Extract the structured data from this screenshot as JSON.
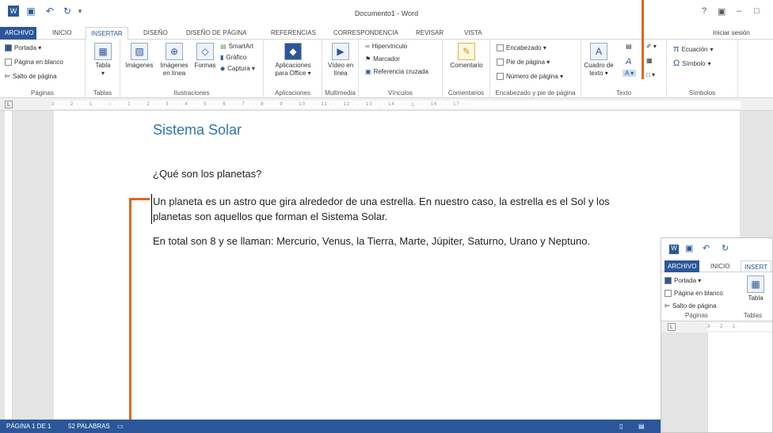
{
  "window": {
    "title": "Documento1 - Word",
    "help": "?",
    "signin": "Iniciar sesión"
  },
  "qat": {
    "word_icon": "word-logo-icon",
    "save": "save-icon",
    "undo": "undo-icon",
    "redo": "redo-icon",
    "customize": "customize-icon"
  },
  "tabs": [
    "ARCHIVO",
    "INICIO",
    "INSERTAR",
    "DISEÑO",
    "DISEÑO DE PÁGINA",
    "REFERENCIAS",
    "CORRESPONDENCIA",
    "REVISAR",
    "VISTA"
  ],
  "ribbon": {
    "paginas": {
      "label": "Páginas",
      "items": [
        "Portada ▾",
        "Página en blanco",
        "Salto de página"
      ]
    },
    "tablas": {
      "label": "Tablas",
      "tabla": "Tabla"
    },
    "ilustraciones": {
      "label": "Ilustraciones",
      "imagenes": "Imágenes",
      "imagenes_linea": "Imágenes en línea",
      "formas": "Formas",
      "smartart": "SmartArt",
      "grafico": "Gráfico",
      "captura": "Captura ▾"
    },
    "aplicaciones": {
      "label": "Aplicaciones",
      "apps": "Aplicaciones para Office ▾"
    },
    "multimedia": {
      "label": "Multimedia",
      "video": "Vídeo en línea"
    },
    "vinculos": {
      "label": "Vínculos",
      "items": [
        "Hipervínculo",
        "Marcador",
        "Referencia cruzada"
      ]
    },
    "comentarios": {
      "label": "Comentarios",
      "comentario": "Comentario"
    },
    "encabezado": {
      "label": "Encabezado y pie de página",
      "items": [
        "Encabezado ▾",
        "Pie de página ▾",
        "Número de página ▾"
      ]
    },
    "texto": {
      "label": "Texto",
      "cuadro": "Cuadro de texto ▾"
    },
    "simbolos": {
      "label": "Símbolos",
      "ecuacion": "Ecuación",
      "simbolo": "Símbolo"
    }
  },
  "ruler": "3 · · · 2 · · · 1 · · · ⌂ · · · 1 · · · 2 · · · 3 · · · 4 · · · 5 · · · 6 · · · 7 · · · 8 · · · 9 · · · 10 · · · 11 · · · 12 · · · 13 · · · 14 · · · △ · · · 16 · · · 17 · · ·",
  "document": {
    "title": "Sistema Solar",
    "heading": "¿Qué son los planetas?",
    "para1": "Un planeta es un astro que gira alrededor de una estrella. En nuestro caso, la estrella es el Sol y los planetas son aquellos que forman el Sistema Solar.",
    "para2": "En total son 8 y se llaman: Mercurio, Venus, la Tierra, Marte, Júpiter, Saturno, Urano y Neptuno."
  },
  "status": {
    "page": "PÁGINA 1 DE 1",
    "words": "52 PALABRAS"
  },
  "inset": {
    "tabs": [
      "ARCHIVO",
      "INICIO",
      "INSERT"
    ],
    "items": [
      "Portada ▾",
      "Página en blanco",
      "Salto de página"
    ],
    "tabla": "Tabla",
    "paginas": "Páginas",
    "tablas": "Tablas",
    "ruler": "3 · · · 2 · · · 1 ·"
  },
  "colors": {
    "accent": "#2b579a",
    "title_blue": "#2e74b5",
    "annotation": "#e0661f"
  }
}
